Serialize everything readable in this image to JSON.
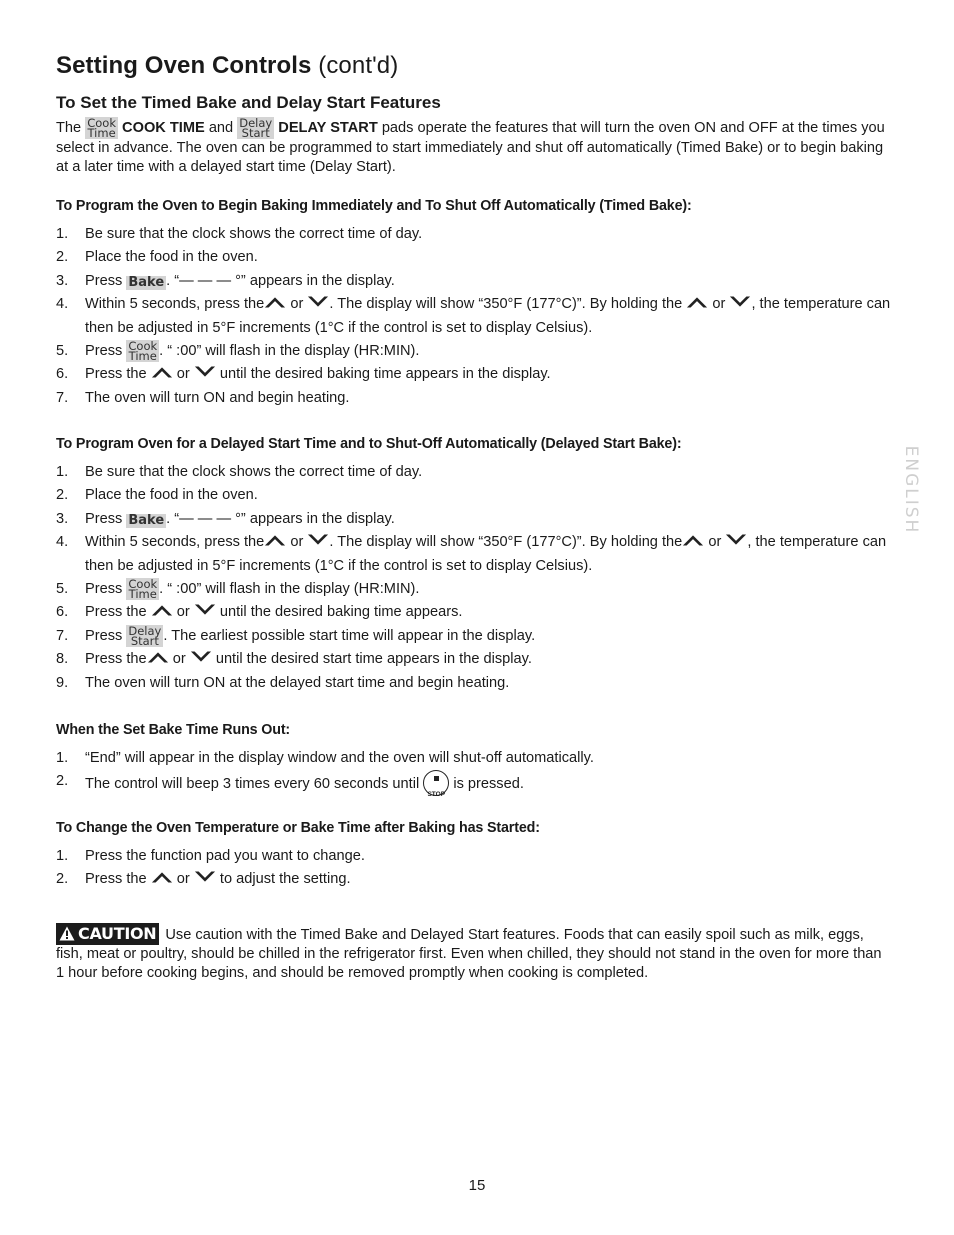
{
  "title": {
    "main": "Setting Oven Controls",
    "sub": "(cont'd)"
  },
  "section_heading": "To Set the Timed Bake and Delay Start Features",
  "pads": {
    "cook_time": [
      "Cook",
      "Time"
    ],
    "delay_start": [
      "Delay",
      "Start"
    ],
    "bake": "Bake",
    "stop": "STOP"
  },
  "icons": {
    "up": "up-arrow-pad",
    "down": "down-arrow-pad",
    "stop": "stop-pad",
    "caution": "warning-triangle"
  },
  "intro": {
    "the": "The",
    "cook_time_label": "COOK TIME",
    "and": "and",
    "delay_start_label": "DELAY START",
    "rest": "pads operate the features that will turn the oven ON and OFF at the times you select in advance. The oven can be programmed to start immediately and shut off automatically (Timed Bake) or to begin baking at a later time with a delayed start time (Delay Start)."
  },
  "timed_bake": {
    "heading": "To Program the Oven to Begin Baking Immediately and To Shut Off Automatically (Timed Bake):",
    "steps": [
      {
        "n": "1.",
        "text": "Be sure that the clock shows the correct time of day."
      },
      {
        "n": "2.",
        "text": "Place the food in the oven."
      },
      {
        "n": "3.",
        "pre": "Press",
        "post": ". “— — — °” appears in the display."
      },
      {
        "n": "4.",
        "pre": "Within 5 seconds, press the",
        "or": "or",
        "mid": ". The display will show “350°F (177°C)”. By holding the",
        "or2": "or",
        "post": ", the temperature can then be adjusted in 5°F increments (1°C if the control is set to display Celsius)."
      },
      {
        "n": "5.",
        "pre": "Press",
        "post": ". “ :00” will flash in the display (HR:MIN)."
      },
      {
        "n": "6.",
        "pre": "Press the",
        "or": "or",
        "post": "until the desired baking time appears in the display."
      },
      {
        "n": "7.",
        "text": "The oven will turn ON and begin heating."
      }
    ]
  },
  "delayed_bake": {
    "heading": "To Program Oven for a Delayed Start Time and to Shut-Off Automatically (Delayed Start Bake):",
    "steps": [
      {
        "n": "1.",
        "text": "Be sure that the clock shows the correct time of day."
      },
      {
        "n": "2.",
        "text": "Place the food in the oven."
      },
      {
        "n": "3.",
        "pre": "Press",
        "post": ". “— — — °” appears in the display."
      },
      {
        "n": "4.",
        "pre": "Within 5 seconds, press the",
        "or": "or",
        "mid": ". The display will show “350°F (177°C)”. By holding the",
        "or2": "or",
        "post": ", the temperature can then be adjusted in 5°F increments (1°C if the control is set to display Celsius)."
      },
      {
        "n": "5.",
        "pre": "Press",
        "post": ". “ :00” will flash in the display (HR:MIN)."
      },
      {
        "n": "6.",
        "pre": "Press the",
        "or": "or",
        "post": "until the desired baking time appears."
      },
      {
        "n": "7.",
        "pre": "Press",
        "post": ". The earliest possible start time will appear in the display."
      },
      {
        "n": "8.",
        "pre": "Press the",
        "or": "or",
        "post": "until the desired start time appears in the display."
      },
      {
        "n": "9.",
        "text": "The oven will turn ON at the delayed start time and begin heating."
      }
    ]
  },
  "runs_out": {
    "heading": "When the Set Bake Time Runs Out:",
    "steps": [
      {
        "n": "1.",
        "text": "“End” will appear in the display window and the oven will shut-off automatically."
      },
      {
        "n": "2.",
        "pre": "The control will beep 3 times every 60 seconds until",
        "post": "is pressed."
      }
    ]
  },
  "change": {
    "heading": "To Change the Oven Temperature or Bake Time after Baking has Started:",
    "steps": [
      {
        "n": "1.",
        "text": "Press the function pad you want to change."
      },
      {
        "n": "2.",
        "pre": "Press the",
        "or": "or",
        "post": "to adjust the setting."
      }
    ]
  },
  "caution": {
    "label": "CAUTION",
    "text": "Use caution with the Timed Bake and Delayed Start features. Foods that can easily spoil such as milk, eggs, fish, meat or poultry, should be chilled in the refrigerator first. Even when chilled, they should not stand in the oven for more than 1 hour before cooking begins, and should be removed promptly when cooking is completed."
  },
  "side_tab": "ENGLISH",
  "page_number": "15"
}
